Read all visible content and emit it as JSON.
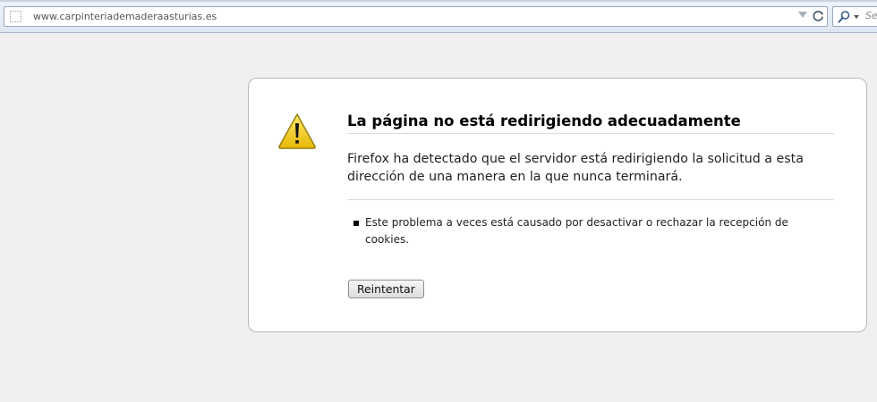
{
  "browser": {
    "url": "www.carpinteriademaderaasturias.es",
    "search_placeholder": "Se",
    "icons": {
      "site": "site-identity-icon",
      "dropmarker": "url-history-dropdown-icon",
      "reload": "reload-icon",
      "search_engine": "search-engine-icon"
    }
  },
  "error": {
    "icon": "warning-icon",
    "title": "La página no está redirigiendo adecuadamente",
    "description": "Firefox ha detectado que el servidor está redirigiendo la solicitud a esta dirección de una manera en la que nunca terminará.",
    "hints": [
      "Este problema a veces está causado por desactivar o rechazar la recepción de cookies."
    ],
    "retry_label": "Reintentar"
  },
  "colors": {
    "page_background": "#f0f0f0",
    "warning_yellow": "#f2cc0c",
    "toolbar_bg": "#dde6f1"
  }
}
